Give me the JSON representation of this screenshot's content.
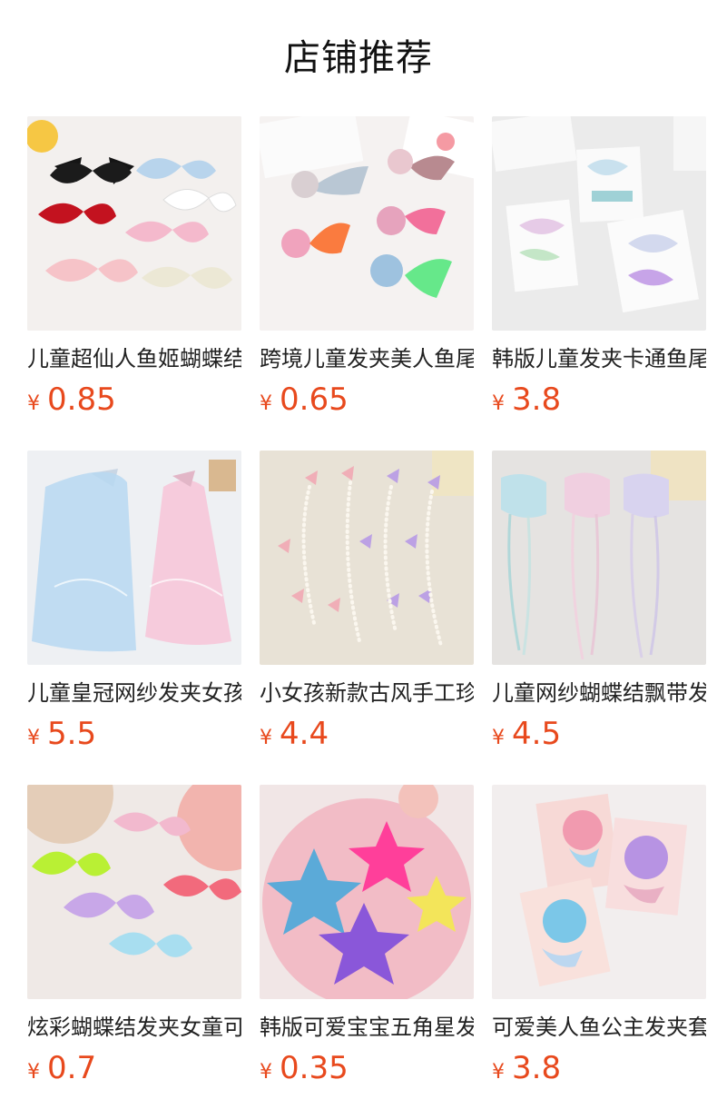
{
  "section_title": "店铺推荐",
  "products": [
    {
      "name": "儿童超仙人鱼姬蝴蝶结发夹",
      "currency": "¥",
      "price": "0.85",
      "image": "bow-hairclips-photo",
      "bg": "#f2efec"
    },
    {
      "name": "跨境儿童发夹美人鱼尾巴发夹",
      "currency": "¥",
      "price": "0.65",
      "image": "mermaid-tail-clips-photo",
      "bg": "#f4f1f0"
    },
    {
      "name": "韩版儿童发夹卡通鱼尾发夹",
      "currency": "¥",
      "price": "3.8",
      "image": "carded-clip-sets-photo",
      "bg": "#eeeeee"
    },
    {
      "name": "儿童皇冠网纱发夹女孩头纱",
      "currency": "¥",
      "price": "5.5",
      "image": "crown-veil-photo",
      "bg": "#eceff3"
    },
    {
      "name": "小女孩新款古风手工珍珠蝴蝶",
      "currency": "¥",
      "price": "4.4",
      "image": "pearl-butterfly-strands-photo",
      "bg": "#e9e3d8"
    },
    {
      "name": "儿童网纱蝴蝶结飘带发夹",
      "currency": "¥",
      "price": "4.5",
      "image": "ribbon-tassel-bows-photo",
      "bg": "#e6e4e2"
    },
    {
      "name": "炫彩蝴蝶结发夹女童可爱",
      "currency": "¥",
      "price": "0.7",
      "image": "iridescent-bows-photo",
      "bg": "#efe9e6"
    },
    {
      "name": "韩版可爱宝宝五角星发夹",
      "currency": "¥",
      "price": "0.35",
      "image": "glitter-star-clips-photo",
      "bg": "#efdadd"
    },
    {
      "name": "可爱美人鱼公主发夹套装",
      "currency": "¥",
      "price": "3.8",
      "image": "mermaid-shell-cards-photo",
      "bg": "#f2eeee"
    }
  ]
}
